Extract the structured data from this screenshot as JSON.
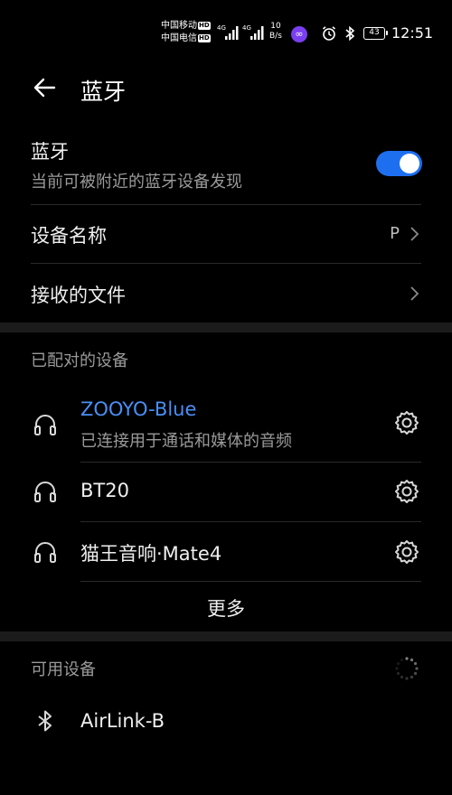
{
  "status_bar": {
    "carrier1": "中国移动",
    "carrier2": "中国电信",
    "hd_label": "HD",
    "signal_type": "4G",
    "net_speed_value": "10",
    "net_speed_unit": "B/s",
    "battery": "43",
    "time": "12:51"
  },
  "header": {
    "title": "蓝牙"
  },
  "bluetooth_toggle": {
    "label": "蓝牙",
    "sublabel": "当前可被附近的蓝牙设备发现",
    "on": true
  },
  "device_name": {
    "label": "设备名称",
    "value": "P"
  },
  "received_files": {
    "label": "接收的文件"
  },
  "paired_section": {
    "title": "已配对的设备",
    "devices": [
      {
        "name": "ZOOYO-Blue",
        "status": "已连接用于通话和媒体的音频",
        "icon": "headset-icon"
      },
      {
        "name": "BT20",
        "status": "",
        "icon": "headset-icon"
      },
      {
        "name": "猫王音响·Mate4",
        "status": "",
        "icon": "headset-icon"
      }
    ],
    "more_label": "更多"
  },
  "available_section": {
    "title": "可用设备",
    "devices": [
      {
        "name": "AirLink-B",
        "icon": "bluetooth-icon"
      }
    ]
  },
  "colors": {
    "accent": "#1e6ff0",
    "connected_text": "#4a8ff5",
    "background": "#000000"
  }
}
